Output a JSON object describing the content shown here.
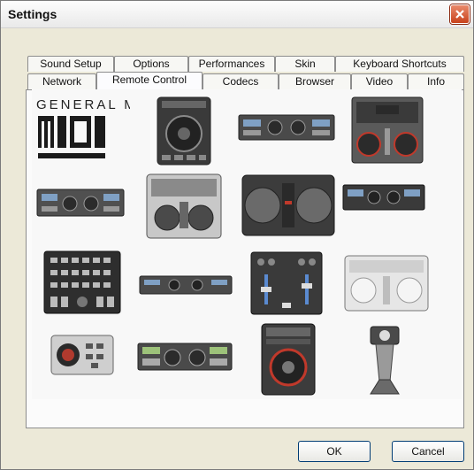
{
  "window": {
    "title": "Settings"
  },
  "tabs": {
    "row1": [
      "Sound Setup",
      "Options",
      "Performances",
      "Skin",
      "Keyboard Shortcuts"
    ],
    "row2": [
      "Network",
      "Remote Control",
      "Codecs",
      "Browser",
      "Video",
      "Info"
    ],
    "active": "Remote Control"
  },
  "controllers": {
    "logo_text": "GENERAL MIDI",
    "items": [
      "general-midi-logo",
      "single-deck-cd-controller",
      "dual-rack-controller",
      "mixer-controller-with-jogs",
      "dual-rack-controller",
      "hercules-controller",
      "twin-jog-controller",
      "dual-rack-controller",
      "grid-button-controller",
      "slim-rack-controller",
      "mixer-controller-with-faders",
      "white-dj-controller",
      "trackball-controller",
      "dual-deck-controller",
      "cd-deck-controller",
      "scanner-light"
    ]
  },
  "buttons": {
    "ok": "OK",
    "cancel": "Cancel"
  },
  "colors": {
    "title_close": "#c8421c",
    "dialog_bg": "#ece9d8"
  }
}
